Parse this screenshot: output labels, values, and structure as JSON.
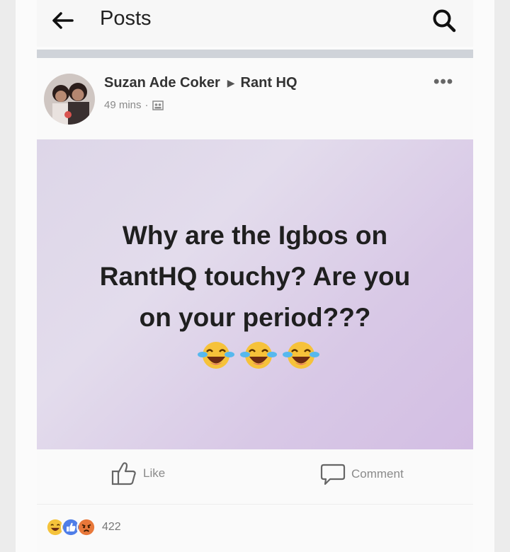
{
  "header": {
    "title": "Posts",
    "back_icon": "back-arrow-icon",
    "search_icon": "search-icon"
  },
  "post": {
    "author": "Suzan Ade Coker",
    "group": "Rant HQ",
    "time": "49 mins",
    "privacy_icon": "group-icon",
    "more_icon": "more-options-icon",
    "text_lines": [
      "Why are the Igbos on",
      "RantHQ touchy? Are you",
      "on your period???"
    ],
    "emoji_icons": [
      "laugh-cry-emoji",
      "laugh-cry-emoji",
      "laugh-cry-emoji"
    ],
    "background_colors": [
      "#ddd6e8",
      "#d3bee3"
    ]
  },
  "actions": {
    "like_label": "Like",
    "comment_label": "Comment"
  },
  "reactions": {
    "types": [
      "haha",
      "like",
      "angry"
    ],
    "count": "422"
  },
  "colors": {
    "separator": "#cfd3d9",
    "meta_text": "#8a8a8a",
    "like_blue": "#4f7ee8",
    "angry_orange": "#e8783a",
    "haha_yellow": "#f5c33b"
  }
}
